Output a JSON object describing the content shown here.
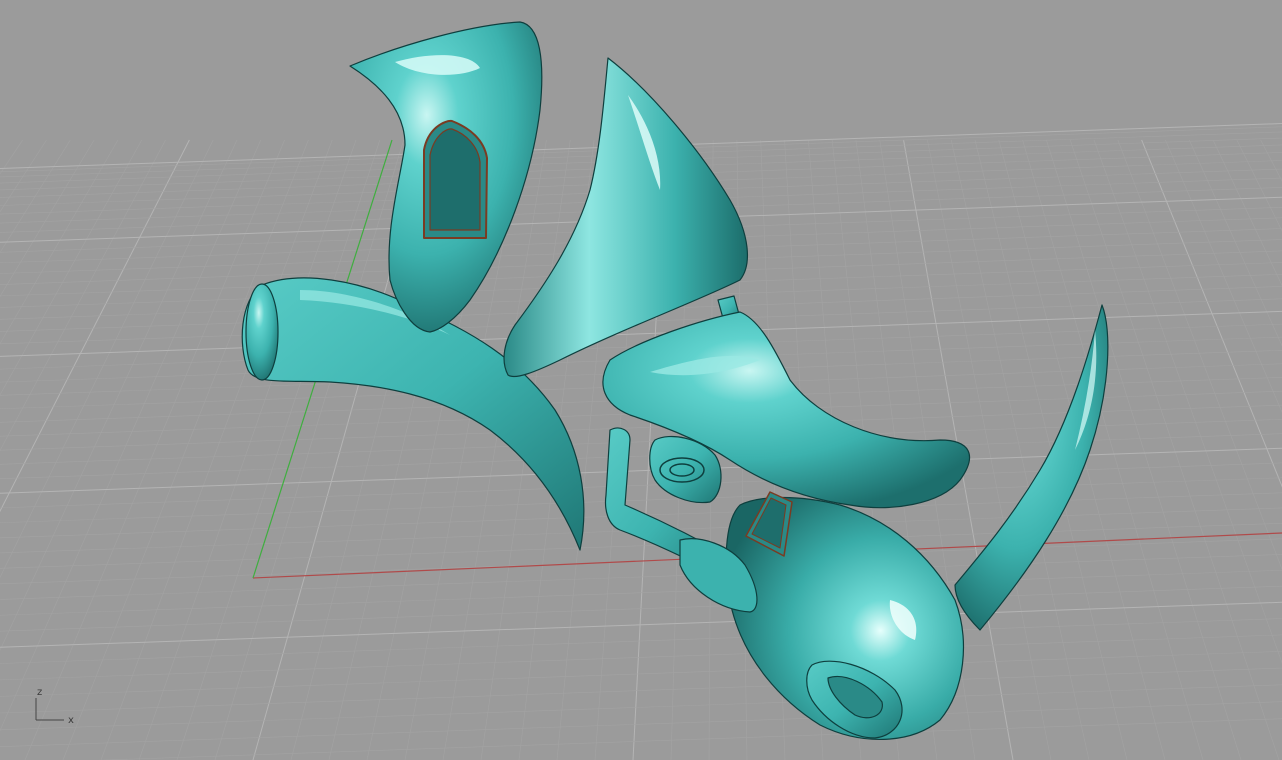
{
  "viewport": {
    "background": "#9b9b9b",
    "grid_minor_color": "#a3a3a3",
    "grid_major_color": "#b4b4b4",
    "x_axis_color": "#b04a4a",
    "y_axis_color": "#3fae3f"
  },
  "model": {
    "surface_color": "#3cb2ae",
    "highlight_color": "#c9f6f2",
    "shadow_color": "#1d6f6d",
    "window_frame_color": "#7a3b22"
  },
  "gizmo": {
    "z_label": "z",
    "x_label": "x"
  }
}
